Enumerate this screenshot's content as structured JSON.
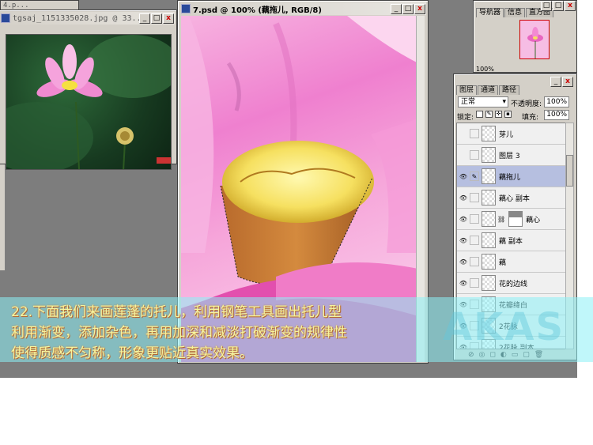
{
  "windows": {
    "thumbnail": {
      "title": "tgsaj_1151335028.jpg @ 33...",
      "buttons": [
        "_",
        "□",
        "x"
      ]
    },
    "main": {
      "title": "7.psd @ 100% (藕拖儿, RGB/8)",
      "buttons": [
        "_",
        "□",
        "x"
      ]
    },
    "minimized": {
      "title": "4.p...",
      "buttons": [
        "□",
        "□",
        "x"
      ]
    }
  },
  "navigator": {
    "tabs": [
      "导航器",
      "信息",
      "直方图"
    ],
    "zoom": "100%"
  },
  "layers_panel": {
    "tabs": [
      "图层",
      "通道",
      "路径"
    ],
    "blend_mode": "正常",
    "opacity_label": "不透明度:",
    "opacity_value": "100%",
    "lock_label": "锁定:",
    "fill_label": "填充:",
    "fill_value": "100%",
    "layers": [
      {
        "name": "芽儿",
        "visible": false,
        "selected": false,
        "has_mask": false
      },
      {
        "name": "图层 3",
        "visible": false,
        "selected": false,
        "has_mask": false
      },
      {
        "name": "藕拖儿",
        "visible": true,
        "selected": true,
        "has_mask": false
      },
      {
        "name": "藕心 副本",
        "visible": true,
        "selected": false,
        "has_mask": false
      },
      {
        "name": "藕心",
        "visible": true,
        "selected": false,
        "has_mask": true
      },
      {
        "name": "藕 副本",
        "visible": true,
        "selected": false,
        "has_mask": false
      },
      {
        "name": "藕",
        "visible": true,
        "selected": false,
        "has_mask": false
      },
      {
        "name": "花的边线",
        "visible": true,
        "selected": false,
        "has_mask": false
      },
      {
        "name": "花瓣绛白",
        "visible": true,
        "selected": false,
        "has_mask": false
      },
      {
        "name": "2花脉",
        "visible": true,
        "selected": false,
        "has_mask": false
      },
      {
        "name": "2花脉 副本",
        "visible": true,
        "selected": false,
        "has_mask": false
      }
    ]
  },
  "caption": {
    "line1": "22.下面我们来画莲蓬的托儿，利用钢笔工具画出托儿型",
    "line2": "利用渐变，添加杂色，再用加深和减淡打破渐变的规律性",
    "line3": "使得质感不匀称，形象更贴近真实效果。"
  },
  "watermark": "AKAS"
}
